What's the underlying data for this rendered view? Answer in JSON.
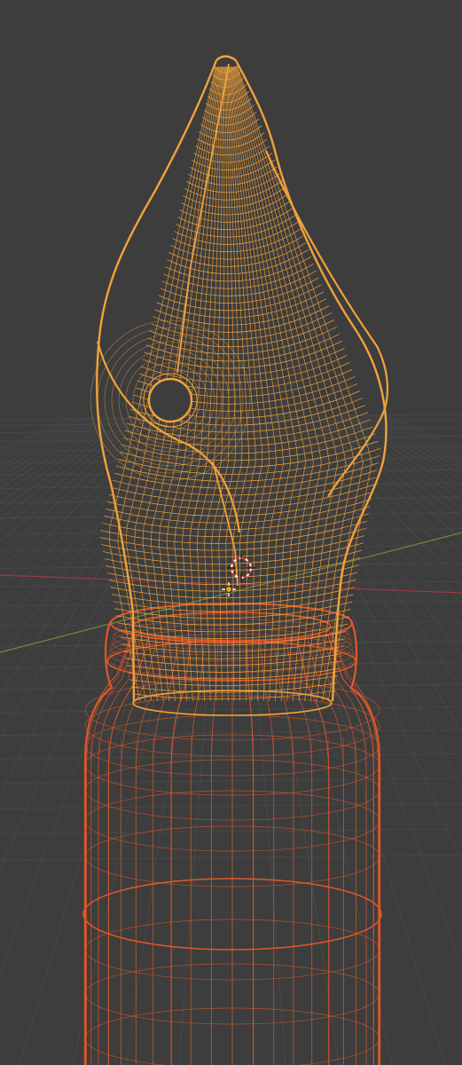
{
  "viewport": {
    "view_mode": "wireframe",
    "background_color": "#3d3d3d",
    "grid_color": "#4a4a4a",
    "x_axis_color": "#9c3a45",
    "y_axis_color": "#6c8a38"
  },
  "objects": [
    {
      "name": "nib",
      "selected": true,
      "active": true,
      "wire_color": "#f2a23a"
    },
    {
      "name": "ink-bottle",
      "selected": true,
      "active": false,
      "wire_color": "#e0582a"
    }
  ],
  "icons": {
    "origin": "object-origin-icon",
    "cursor": "3d-cursor-icon"
  }
}
